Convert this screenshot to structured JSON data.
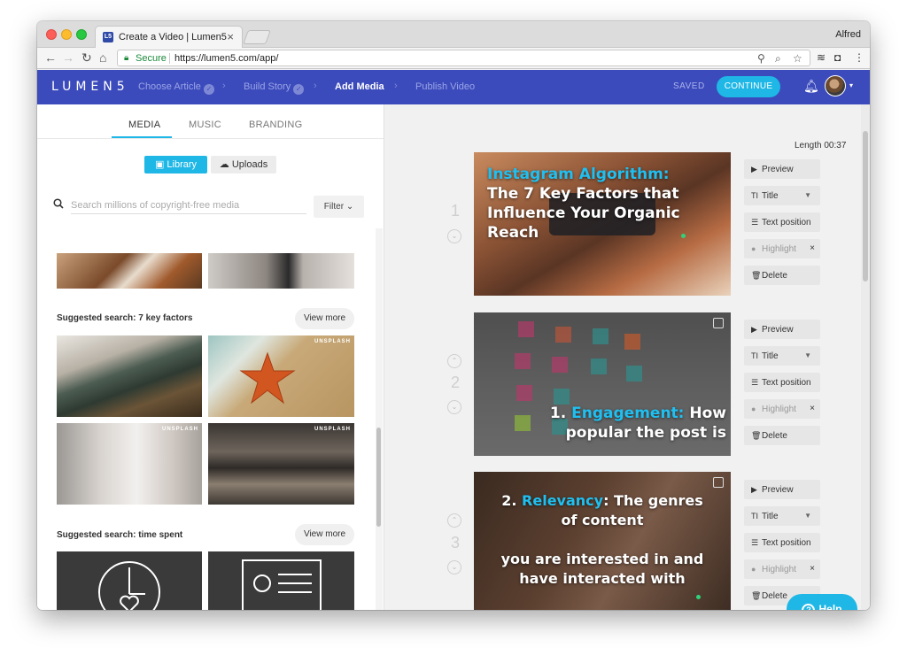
{
  "browser": {
    "tab_title": "Create a Video | Lumen5",
    "tab_favicon": "L5",
    "profile_name": "Alfred",
    "secure_label": "Secure",
    "url": "https://lumen5.com/app/"
  },
  "app": {
    "logo": "LUMEN5",
    "steps": [
      {
        "label": "Choose Article",
        "done": true
      },
      {
        "label": "Build Story",
        "done": true
      },
      {
        "label": "Add Media",
        "active": true
      },
      {
        "label": "Publish Video"
      }
    ],
    "saved_label": "SAVED",
    "continue_label": "CONTINUE"
  },
  "media_panel": {
    "tabs": [
      "MEDIA",
      "MUSIC",
      "BRANDING"
    ],
    "library_label": "Library",
    "uploads_label": "Uploads",
    "search_placeholder": "Search millions of copyright-free media",
    "filter_label": "Filter",
    "suggestions": [
      {
        "label": "Suggested search: 7 key factors",
        "view_more": "View more"
      },
      {
        "label": "Suggested search: time spent",
        "view_more": "View more"
      }
    ],
    "unsplash_badge": "UNSPLASH"
  },
  "story_panel": {
    "length_label": "Length 00:37",
    "scenes": [
      {
        "number": "1",
        "text_highlight": "Instagram Algorithm:",
        "text_rest": "The 7 Key Factors that Influence Your Organic Reach"
      },
      {
        "number": "2",
        "text_prefix": "1. ",
        "text_highlight": "Engagement:",
        "text_rest": " How popular the post is"
      },
      {
        "number": "3",
        "text_prefix": "2. ",
        "text_highlight": "Relevancy",
        "text_rest": ": The genres of content",
        "text_rest2": "you are interested in and have interacted with"
      }
    ],
    "actions": {
      "preview": "Preview",
      "title": "Title",
      "text_position": "Text position",
      "highlight": "Highlight",
      "delete": "Delete"
    },
    "help_label": "Help"
  },
  "colors": {
    "brand": "#3c4bbc",
    "accent": "#1fb7e6",
    "highlight_text": "#1fc0f1"
  }
}
